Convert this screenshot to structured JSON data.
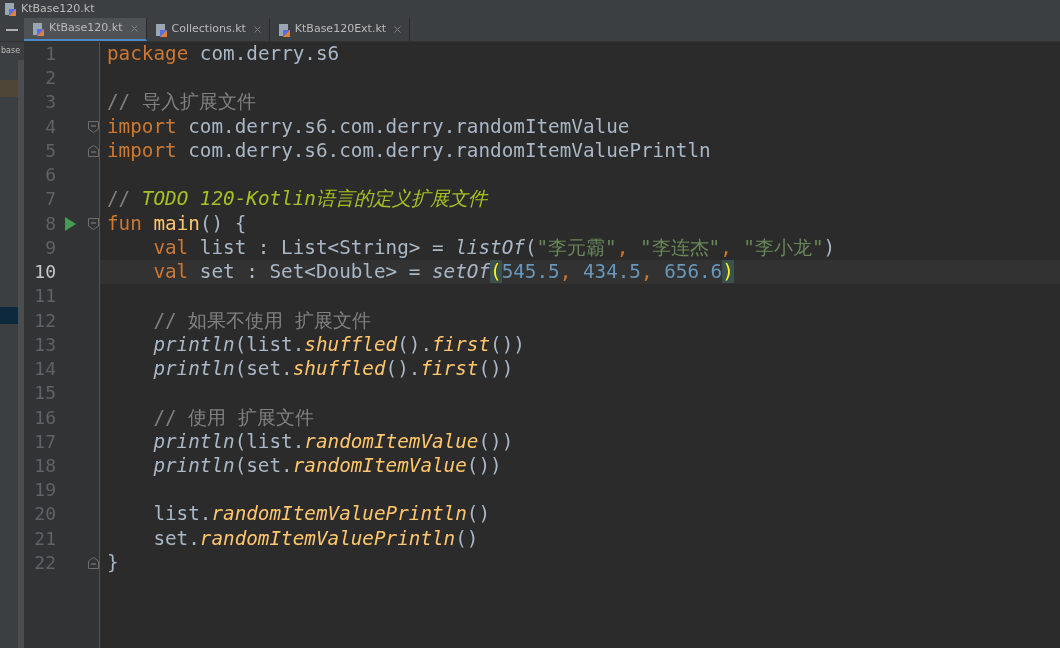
{
  "window": {
    "title": "KtBase120.kt"
  },
  "tabs": [
    {
      "label": "KtBase120.kt",
      "selected": true
    },
    {
      "label": "Collections.kt",
      "selected": false
    },
    {
      "label": "KtBase120Ext.kt",
      "selected": false
    }
  ],
  "project_panel": {
    "label": "base"
  },
  "editor": {
    "lines": [
      {
        "number": "1",
        "current": false,
        "runnable": false,
        "fold_start": false,
        "fold_end": false,
        "indented": false,
        "tokens": [
          {
            "kind": "keyword",
            "text": "package"
          },
          {
            "kind": "plain",
            "text": " com.derry.s6"
          }
        ]
      },
      {
        "number": "2",
        "current": false,
        "runnable": false,
        "fold_start": false,
        "fold_end": false
      },
      {
        "number": "3",
        "current": false,
        "runnable": false,
        "fold_start": false,
        "fold_end": false,
        "indented": false,
        "tokens": [
          {
            "kind": "comment",
            "text": "// 导入扩展文件"
          }
        ]
      },
      {
        "number": "4",
        "current": false,
        "runnable": false,
        "fold_start": true,
        "fold_end": false,
        "indented": false,
        "tokens": [
          {
            "kind": "keyword",
            "text": "import"
          },
          {
            "kind": "plain",
            "text": " com.derry.s6.com.derry.randomItemValue"
          }
        ]
      },
      {
        "number": "5",
        "current": false,
        "runnable": false,
        "fold_start": false,
        "fold_end": true,
        "indented": false,
        "tokens": [
          {
            "kind": "keyword",
            "text": "import"
          },
          {
            "kind": "plain",
            "text": " com.derry.s6.com.derry.randomItemValuePrintln"
          }
        ]
      },
      {
        "number": "6",
        "current": false,
        "runnable": false,
        "fold_start": false,
        "fold_end": false
      },
      {
        "number": "7",
        "current": false,
        "runnable": false,
        "fold_start": false,
        "fold_end": false,
        "indented": false,
        "tokens": [
          {
            "kind": "comment",
            "text": "// "
          },
          {
            "kind": "todo",
            "text": "TODO 120-Kotlin语言的定义扩展文件"
          }
        ]
      },
      {
        "number": "8",
        "current": false,
        "runnable": true,
        "fold_start": true,
        "fold_end": false,
        "indented": false,
        "tokens": [
          {
            "kind": "keyword",
            "text": "fun "
          },
          {
            "kind": "declaration",
            "text": "main"
          },
          {
            "kind": "plain",
            "text": "() {"
          }
        ]
      },
      {
        "number": "9",
        "current": false,
        "runnable": false,
        "fold_start": false,
        "fold_end": false,
        "indented": true,
        "tokens": [
          {
            "kind": "keyword",
            "text": "val"
          },
          {
            "kind": "plain",
            "text": " list : List<String> = "
          },
          {
            "kind": "call",
            "text": "listOf"
          },
          {
            "kind": "plain",
            "text": "("
          },
          {
            "kind": "string",
            "text": "\"李元霸\""
          },
          {
            "kind": "keyword",
            "text": ", "
          },
          {
            "kind": "string",
            "text": "\"李连杰\""
          },
          {
            "kind": "keyword",
            "text": ", "
          },
          {
            "kind": "string",
            "text": "\"李小龙\""
          },
          {
            "kind": "plain",
            "text": ")"
          }
        ]
      },
      {
        "number": "10",
        "current": true,
        "runnable": false,
        "fold_start": false,
        "fold_end": false,
        "indented": true,
        "tokens": [
          {
            "kind": "keyword",
            "text": "val"
          },
          {
            "kind": "plain",
            "text": " set : Set<Double> = "
          },
          {
            "kind": "call",
            "text": "setOf"
          },
          {
            "kind": "brace",
            "text": "("
          },
          {
            "kind": "number",
            "text": "545.5"
          },
          {
            "kind": "keyword",
            "text": ", "
          },
          {
            "kind": "number",
            "text": "434.5"
          },
          {
            "kind": "keyword",
            "text": ", "
          },
          {
            "kind": "number",
            "text": "656.6"
          },
          {
            "kind": "brace",
            "text": ")"
          }
        ]
      },
      {
        "number": "11",
        "current": false,
        "runnable": false,
        "fold_start": false,
        "fold_end": false
      },
      {
        "number": "12",
        "current": false,
        "runnable": false,
        "fold_start": false,
        "fold_end": false,
        "indented": true,
        "tokens": [
          {
            "kind": "comment",
            "text": "// 如果不使用 扩展文件"
          }
        ]
      },
      {
        "number": "13",
        "current": false,
        "runnable": false,
        "fold_start": false,
        "fold_end": false,
        "indented": true,
        "tokens": [
          {
            "kind": "call",
            "text": "println"
          },
          {
            "kind": "plain",
            "text": "(list."
          },
          {
            "kind": "extension",
            "text": "shuffled"
          },
          {
            "kind": "plain",
            "text": "()."
          },
          {
            "kind": "extension",
            "text": "first"
          },
          {
            "kind": "plain",
            "text": "())"
          }
        ]
      },
      {
        "number": "14",
        "current": false,
        "runnable": false,
        "fold_start": false,
        "fold_end": false,
        "indented": true,
        "tokens": [
          {
            "kind": "call",
            "text": "println"
          },
          {
            "kind": "plain",
            "text": "(set."
          },
          {
            "kind": "extension",
            "text": "shuffled"
          },
          {
            "kind": "plain",
            "text": "()."
          },
          {
            "kind": "extension",
            "text": "first"
          },
          {
            "kind": "plain",
            "text": "())"
          }
        ]
      },
      {
        "number": "15",
        "current": false,
        "runnable": false,
        "fold_start": false,
        "fold_end": false
      },
      {
        "number": "16",
        "current": false,
        "runnable": false,
        "fold_start": false,
        "fold_end": false,
        "indented": true,
        "tokens": [
          {
            "kind": "comment",
            "text": "// 使用 扩展文件"
          }
        ]
      },
      {
        "number": "17",
        "current": false,
        "runnable": false,
        "fold_start": false,
        "fold_end": false,
        "indented": true,
        "tokens": [
          {
            "kind": "call",
            "text": "println"
          },
          {
            "kind": "plain",
            "text": "(list."
          },
          {
            "kind": "extension",
            "text": "randomItemValue"
          },
          {
            "kind": "plain",
            "text": "())"
          }
        ]
      },
      {
        "number": "18",
        "current": false,
        "runnable": false,
        "fold_start": false,
        "fold_end": false,
        "indented": true,
        "tokens": [
          {
            "kind": "call",
            "text": "println"
          },
          {
            "kind": "plain",
            "text": "(set."
          },
          {
            "kind": "extension",
            "text": "randomItemValue"
          },
          {
            "kind": "plain",
            "text": "())"
          }
        ]
      },
      {
        "number": "19",
        "current": false,
        "runnable": false,
        "fold_start": false,
        "fold_end": false
      },
      {
        "number": "20",
        "current": false,
        "runnable": false,
        "fold_start": false,
        "fold_end": false,
        "indented": true,
        "tokens": [
          {
            "kind": "plain",
            "text": "list."
          },
          {
            "kind": "extension",
            "text": "randomItemValuePrintln"
          },
          {
            "kind": "plain",
            "text": "()"
          }
        ]
      },
      {
        "number": "21",
        "current": false,
        "runnable": false,
        "fold_start": false,
        "fold_end": false,
        "indented": true,
        "tokens": [
          {
            "kind": "plain",
            "text": "set."
          },
          {
            "kind": "extension",
            "text": "randomItemValuePrintln"
          },
          {
            "kind": "plain",
            "text": "()"
          }
        ]
      },
      {
        "number": "22",
        "current": false,
        "runnable": false,
        "fold_start": false,
        "fold_end": true,
        "indented": false,
        "tokens": [
          {
            "kind": "plain",
            "text": "}"
          }
        ]
      }
    ]
  }
}
